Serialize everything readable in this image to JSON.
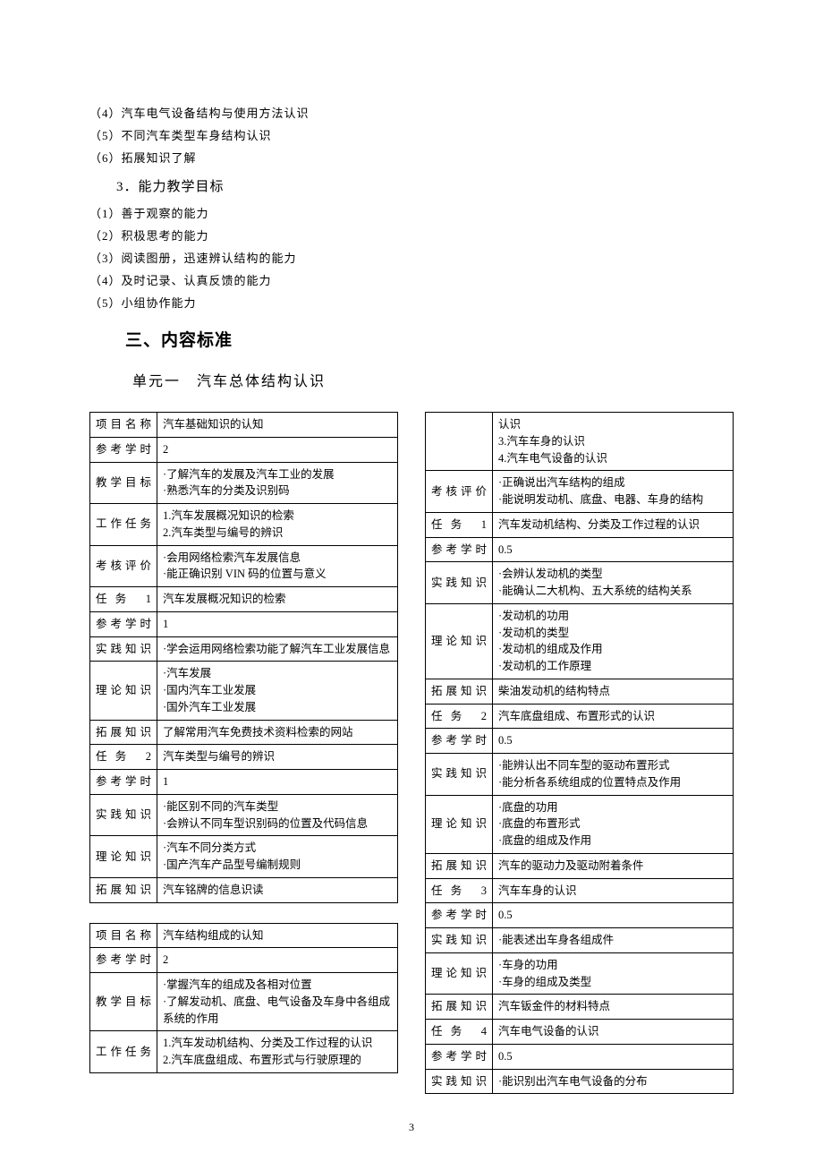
{
  "intro_items": [
    "（4）汽车电气设备结构与使用方法认识",
    "（5）不同汽车类型车身结构认识",
    "（6）拓展知识了解"
  ],
  "subhead_3": "3．能力教学目标",
  "ability_items": [
    "（1）善于观察的能力",
    "（2）积极思考的能力",
    "（3）阅读图册，迅速辨认结构的能力",
    "（4）及时记录、认真反馈的能力",
    "（5）小组协作能力"
  ],
  "section_heading": "三、内容标准",
  "unit_title": "单元一　汽车总体结构认识",
  "table1": [
    [
      "项目名称",
      "汽车基础知识的认知"
    ],
    [
      "参考学时",
      "2"
    ],
    [
      "教学目标",
      "·了解汽车的发展及汽车工业的发展\n·熟悉汽车的分类及识别码"
    ],
    [
      "工作任务",
      "1.汽车发展概况知识的检索\n2.汽车类型与编号的辨识"
    ],
    [
      "考核评价",
      "·会用网络检索汽车发展信息\n·能正确识别 VIN 码的位置与意义"
    ],
    [
      "任务 1",
      "汽车发展概况知识的检索"
    ],
    [
      "参考学时",
      "1"
    ],
    [
      "实践知识",
      "·学会运用网络检索功能了解汽车工业发展信息"
    ],
    [
      "理论知识",
      "·汽车发展\n·国内汽车工业发展\n·国外汽车工业发展"
    ],
    [
      "拓展知识",
      "了解常用汽车免费技术资料检索的网站"
    ],
    [
      "任务 2",
      "汽车类型与编号的辨识"
    ],
    [
      "参考学时",
      "1"
    ],
    [
      "实践知识",
      "·能区别不同的汽车类型\n·会辨认不同车型识别码的位置及代码信息"
    ],
    [
      "理论知识",
      "·汽车不同分类方式\n·国产汽车产品型号编制规则"
    ],
    [
      "拓展知识",
      "汽车铭牌的信息识读"
    ]
  ],
  "table2": [
    [
      "项目名称",
      "汽车结构组成的认知"
    ],
    [
      "参考学时",
      "2"
    ],
    [
      "教学目标",
      "·掌握汽车的组成及各相对位置\n·了解发动机、底盘、电气设备及车身中各组成系统的作用"
    ],
    [
      "工作任务",
      "1.汽车发动机结构、分类及工作过程的认识\n2.汽车底盘组成、布置形式与行驶原理的"
    ]
  ],
  "table3": [
    [
      "",
      "认识\n3.汽车车身的认识\n4.汽车电气设备的认识"
    ],
    [
      "考核评价",
      "·正确说出汽车结构的组成\n·能说明发动机、底盘、电器、车身的结构"
    ],
    [
      "任务 1",
      "汽车发动机结构、分类及工作过程的认识"
    ],
    [
      "参考学时",
      "0.5"
    ],
    [
      "实践知识",
      "·会辨认发动机的类型\n·能确认二大机构、五大系统的结构关系"
    ],
    [
      "理论知识",
      "·发动机的功用\n·发动机的类型\n·发动机的组成及作用\n·发动机的工作原理"
    ],
    [
      "拓展知识",
      "柴油发动机的结构特点"
    ],
    [
      "任务 2",
      "汽车底盘组成、布置形式的认识"
    ],
    [
      "参考学时",
      "0.5"
    ],
    [
      "实践知识",
      "·能辨认出不同车型的驱动布置形式\n·能分析各系统组成的位置特点及作用"
    ],
    [
      "理论知识",
      "·底盘的功用\n·底盘的布置形式\n·底盘的组成及作用"
    ],
    [
      "拓展知识",
      "汽车的驱动力及驱动附着条件"
    ],
    [
      "任务 3",
      "汽车车身的认识"
    ],
    [
      "参考学时",
      "0.5"
    ],
    [
      "实践知识",
      "·能表述出车身各组成件"
    ],
    [
      "理论知识",
      "·车身的功用\n·车身的组成及类型"
    ],
    [
      "拓展知识",
      "汽车钣金件的材料特点"
    ],
    [
      "任务 4",
      "汽车电气设备的认识"
    ],
    [
      "参考学时",
      "0.5"
    ],
    [
      "实践知识",
      "·能识别出汽车电气设备的分布"
    ]
  ],
  "page_number": "3"
}
